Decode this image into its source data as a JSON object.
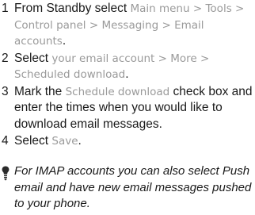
{
  "steps": [
    {
      "num": "1",
      "parts": [
        {
          "t": "From Standby select ",
          "ui": false
        },
        {
          "t": "Main menu >",
          "ui": true
        },
        {
          "t": " ",
          "ui": false
        },
        {
          "t": "Tools > Control panel > Messaging >",
          "ui": true
        },
        {
          "t": " ",
          "ui": false
        },
        {
          "t": "Email accounts",
          "ui": true
        },
        {
          "t": ".",
          "ui": false
        }
      ]
    },
    {
      "num": "2",
      "parts": [
        {
          "t": "Select ",
          "ui": false
        },
        {
          "t": "your email account > More >",
          "ui": true
        },
        {
          "t": " ",
          "ui": false
        },
        {
          "t": "Scheduled download",
          "ui": true
        },
        {
          "t": ".",
          "ui": false
        }
      ]
    },
    {
      "num": "3",
      "parts": [
        {
          "t": "Mark the ",
          "ui": false
        },
        {
          "t": "Schedule download",
          "ui": true
        },
        {
          "t": " check box and enter the times when you would like to download email messages.",
          "ui": false
        }
      ]
    },
    {
      "num": "4",
      "parts": [
        {
          "t": "Select ",
          "ui": false
        },
        {
          "t": "Save",
          "ui": true
        },
        {
          "t": ".",
          "ui": false
        }
      ]
    }
  ],
  "tip": {
    "icon": "lightbulb-icon",
    "text": "For IMAP accounts you can also select Push email and have new email messages pushed to your phone."
  },
  "colors": {
    "body_text": "#1a1a1a",
    "ui_text": "#9a9a9a"
  }
}
